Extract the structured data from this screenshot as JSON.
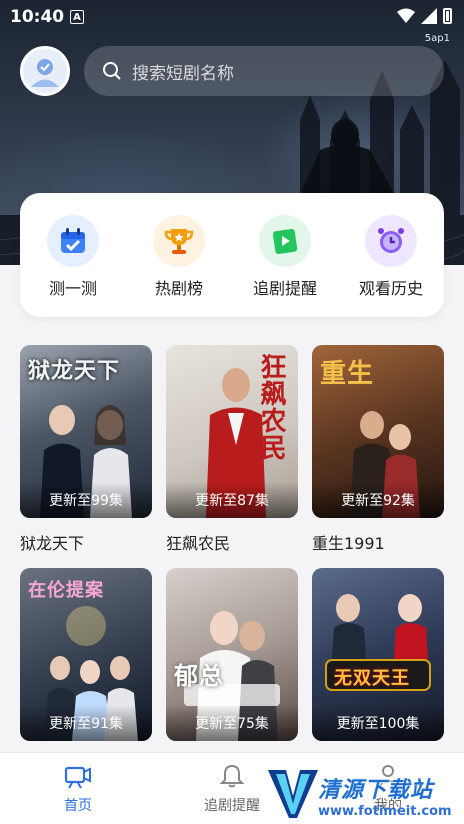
{
  "status_bar": {
    "time": "10:40",
    "badge": "A",
    "carrier": "5ap1"
  },
  "header": {
    "search_placeholder": "搜索短剧名称"
  },
  "quick_menu": [
    {
      "label": "测一测",
      "icon": "calendar-check-icon",
      "color": "#3b82f6"
    },
    {
      "label": "热剧榜",
      "icon": "trophy-icon",
      "color": "#f59e0b"
    },
    {
      "label": "追剧提醒",
      "icon": "bookmark-play-icon",
      "color": "#22c55e"
    },
    {
      "label": "观看历史",
      "icon": "alarm-clock-icon",
      "color": "#8b5cf6"
    }
  ],
  "dramas": [
    {
      "title": "狱龙天下",
      "episodes": "更新至99集",
      "poster_text": "狱龙天下",
      "colors": [
        "#6b7280",
        "#1f2937"
      ]
    },
    {
      "title": "狂飙农民",
      "episodes": "更新至87集",
      "poster_text": "狂飙农民",
      "colors": [
        "#d6d3cf",
        "#b91c1c"
      ]
    },
    {
      "title": "重生1991",
      "episodes": "更新至92集",
      "poster_text": "重生",
      "colors": [
        "#7c4a2a",
        "#2a1a12"
      ]
    },
    {
      "title": "",
      "episodes": "更新至91集",
      "poster_text": "在伦提案",
      "colors": [
        "#4b5563",
        "#111827"
      ]
    },
    {
      "title": "",
      "episodes": "更新至75集",
      "poster_text": "郁总",
      "colors": [
        "#c9c3c0",
        "#5a4a45"
      ]
    },
    {
      "title": "",
      "episodes": "更新至100集",
      "poster_text": "无双天王",
      "colors": [
        "#3b4a6b",
        "#1a1e2e"
      ]
    }
  ],
  "bottom_nav": {
    "home": "首页",
    "follow": "追剧提醒",
    "mine": "我的"
  },
  "watermark": {
    "name": "清源下载站",
    "url": "www.fotimeit.com"
  }
}
